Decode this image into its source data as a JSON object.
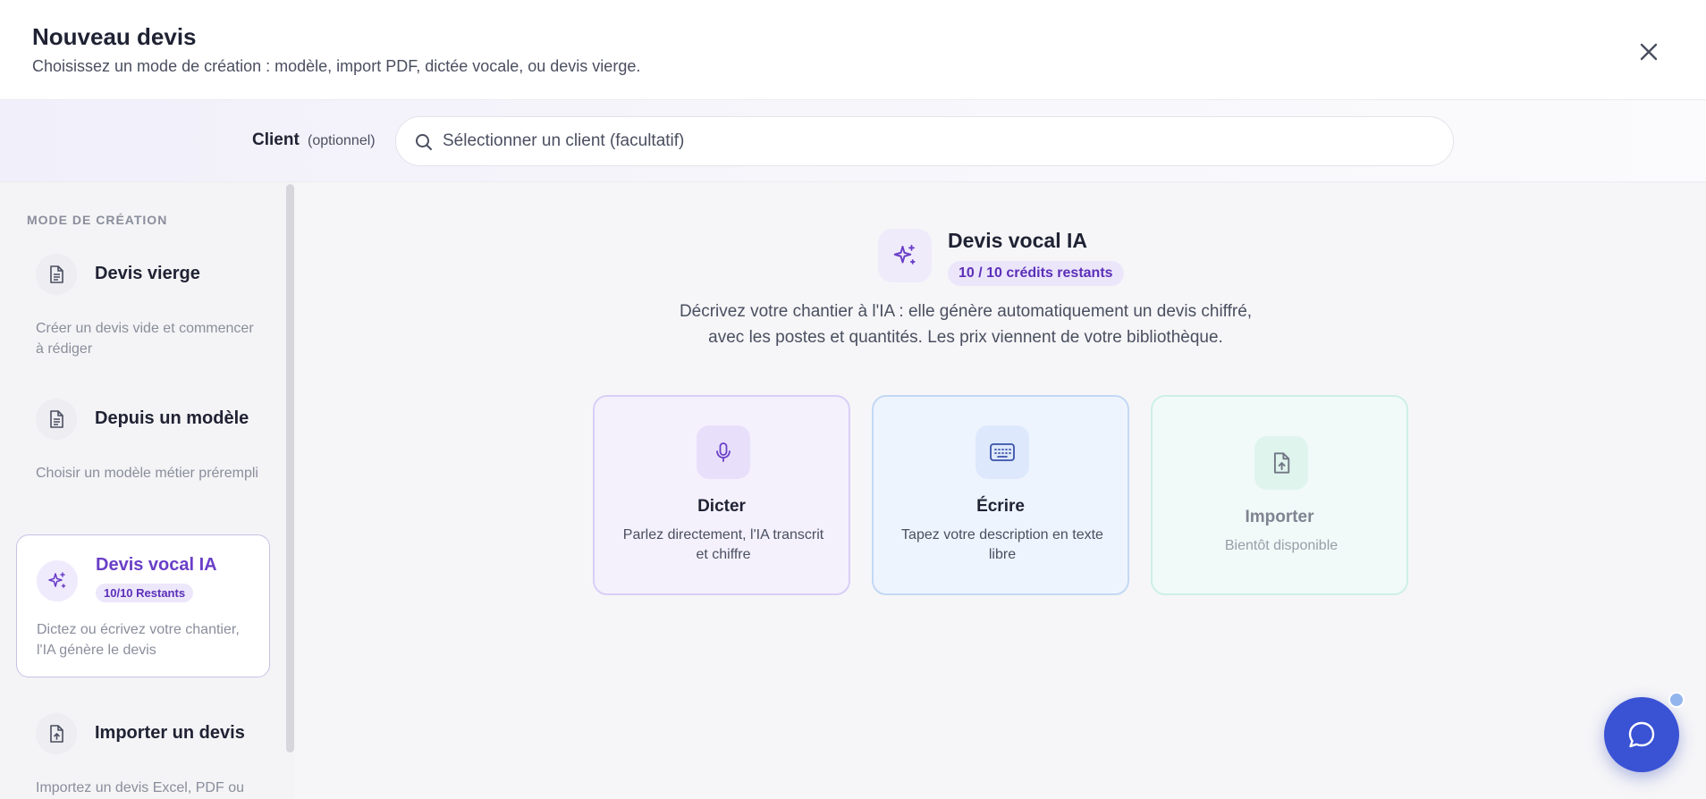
{
  "header": {
    "title": "Nouveau devis",
    "subtitle": "Choisissez un mode de création : modèle, import PDF, dictée vocale, ou devis vierge.",
    "close_icon": "close-icon"
  },
  "client": {
    "label": "Client",
    "optional": "(optionnel)",
    "placeholder": "Sélectionner un client (facultatif)",
    "icon": "search-icon"
  },
  "sidebar": {
    "heading": "MODE DE CRÉATION",
    "modes": [
      {
        "title": "Devis vierge",
        "desc": "Créer un devis vide et commencer à rédiger",
        "icon": "document-icon"
      },
      {
        "title": "Depuis un modèle",
        "desc": "Choisir un modèle métier prérempli",
        "icon": "document-icon"
      },
      {
        "title": "Devis vocal IA",
        "badge": "10/10 Restants",
        "desc": "Dictez ou écrivez votre chantier, l'IA génère le devis",
        "icon": "sparkles-icon",
        "active": true
      },
      {
        "title": "Importer un devis",
        "desc": "Importez un devis Excel, PDF ou DPGF existant",
        "icon": "file-upload-icon"
      }
    ]
  },
  "main": {
    "title": "Devis vocal IA",
    "badge": "10 / 10 crédits restants",
    "desc_line1": "Décrivez votre chantier à l'IA : elle génère automatiquement un devis chiffré,",
    "desc_line2": "avec les postes et quantités. Les prix viennent de votre bibliothèque.",
    "cards": [
      {
        "title": "Dicter",
        "desc": "Parlez directement, l'IA transcrit et chiffre",
        "icon": "microphone-icon"
      },
      {
        "title": "Écrire",
        "desc": "Tapez votre description en texte libre",
        "icon": "keyboard-icon"
      },
      {
        "title": "Importer",
        "desc": "Bientôt disponible",
        "icon": "file-upload-icon",
        "disabled": true
      }
    ]
  },
  "chat": {
    "icon": "chat-bubble-icon"
  },
  "colors": {
    "accent": "#6a3fc7",
    "chat": "#3a52d4",
    "badge_bg": "#ece6fb"
  }
}
